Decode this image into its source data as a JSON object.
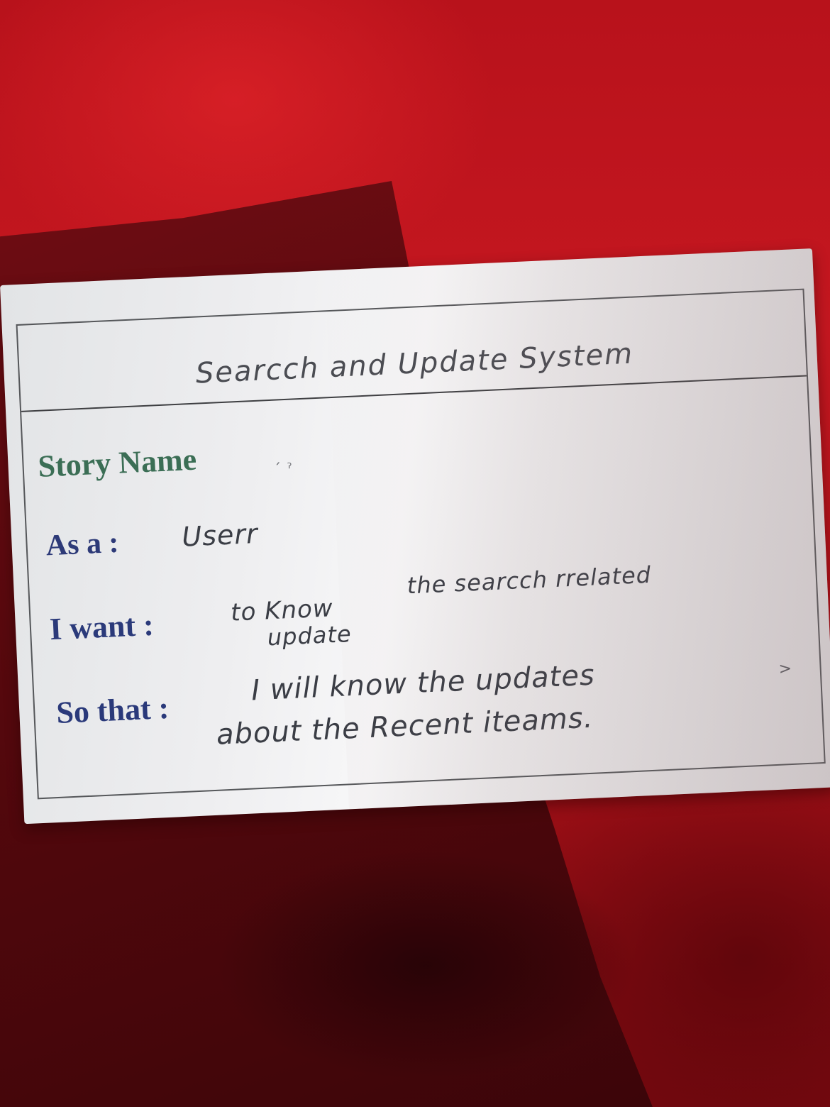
{
  "photo": {
    "background_color": "#c8121a",
    "cloth_color": "#55080d",
    "card_color": "#f2f2f3"
  },
  "card": {
    "handwritten_title": "Searcch and Update System",
    "story_name": {
      "label": "Story Name"
    },
    "as_a": {
      "label": "As a :",
      "value": "Userr"
    },
    "i_want": {
      "label": "I want :",
      "value_line1": "to Know",
      "value_line2": "the searcch rrelated",
      "value_line3": "update"
    },
    "so_that": {
      "label": "So that :",
      "value_line1": "I will know the updates",
      "value_line2": "about the Recent iteams."
    },
    "label_colors": {
      "story_name": "#3b6e55",
      "fields": "#2b3a7a"
    }
  }
}
